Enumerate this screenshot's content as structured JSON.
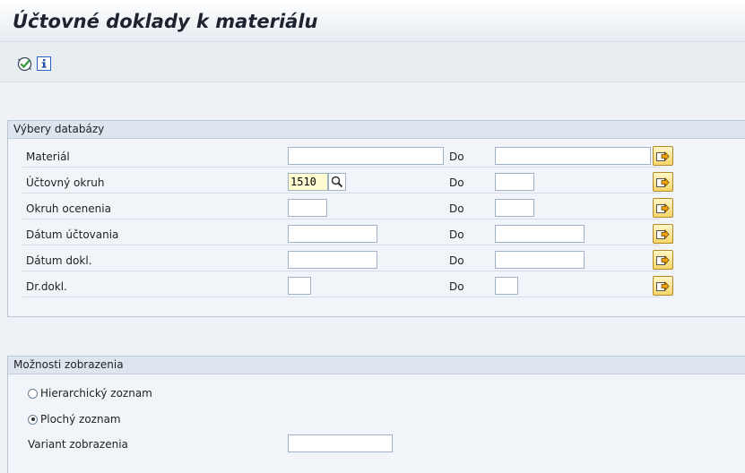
{
  "title": "Účtovné doklady k materiálu",
  "toolbar": {
    "execute_icon": "execute-icon",
    "info_icon": "info-icon"
  },
  "db_selection": {
    "title": "Výbery databázy",
    "to_label": "Do",
    "rows": [
      {
        "label": "Materiál",
        "from": "",
        "to": ""
      },
      {
        "label": "Účtovný okruh",
        "from": "1510",
        "to": ""
      },
      {
        "label": "Okruh ocenenia",
        "from": "",
        "to": ""
      },
      {
        "label": "Dátum účtovania",
        "from": "",
        "to": ""
      },
      {
        "label": "Dátum dokl.",
        "from": "",
        "to": ""
      },
      {
        "label": "Dr.dokl.",
        "from": "",
        "to": ""
      }
    ]
  },
  "display_options": {
    "title": "Možnosti zobrazenia",
    "radio_hierarchical": "Hierarchický zoznam",
    "radio_flat": "Plochý zoznam",
    "selected": "flat",
    "variant_label": "Variant zobrazenia",
    "variant_value": ""
  },
  "colors": {
    "accent": "#f7d66a",
    "background": "#eef2f6"
  }
}
